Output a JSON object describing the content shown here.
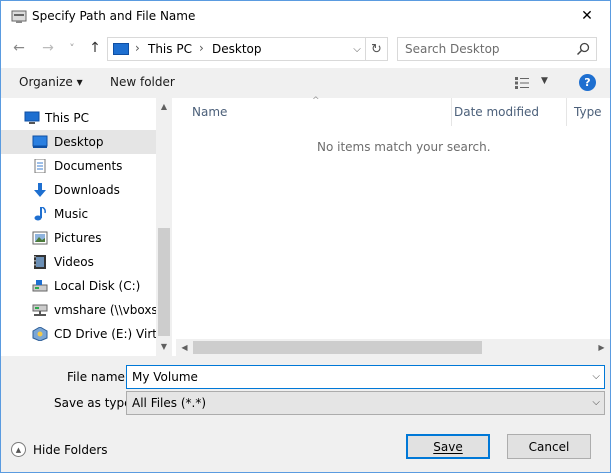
{
  "window": {
    "title": "Specify Path and File Name",
    "close_glyph": "✕"
  },
  "address_bar": {
    "back_glyph": "←",
    "forward_glyph": "→",
    "recent_glyph": "˅",
    "up_glyph": "↑",
    "crumbs": [
      "This PC",
      "Desktop"
    ],
    "separator": "›",
    "dropdown_glyph": "⌵",
    "refresh_glyph": "↻"
  },
  "search": {
    "placeholder": "Search Desktop"
  },
  "toolbar": {
    "organize_label": "Organize ▾",
    "new_folder_label": "New folder",
    "view_dropdown_glyph": "▼",
    "help_glyph": "?"
  },
  "nav": {
    "items": [
      {
        "label": "This PC",
        "icon": "this-pc-icon",
        "selected": false
      },
      {
        "label": "Desktop",
        "icon": "desktop-icon",
        "selected": true
      },
      {
        "label": "Documents",
        "icon": "documents-icon",
        "selected": false
      },
      {
        "label": "Downloads",
        "icon": "downloads-icon",
        "selected": false
      },
      {
        "label": "Music",
        "icon": "music-icon",
        "selected": false
      },
      {
        "label": "Pictures",
        "icon": "pictures-icon",
        "selected": false
      },
      {
        "label": "Videos",
        "icon": "videos-icon",
        "selected": false
      },
      {
        "label": "Local Disk (C:)",
        "icon": "local-disk-icon",
        "selected": false
      },
      {
        "label": "vmshare (\\\\vboxsrv",
        "icon": "network-drive-icon",
        "selected": false
      },
      {
        "label": "CD Drive (E:) Virtua",
        "icon": "cd-drive-icon",
        "selected": false
      }
    ],
    "scroll_up_glyph": "▲",
    "scroll_down_glyph": "▼"
  },
  "file_list": {
    "columns": [
      "Name",
      "Date modified",
      "Type"
    ],
    "sort_glyph": "^",
    "empty_message": "No items match your search.",
    "scroll_left_glyph": "◀",
    "scroll_right_glyph": "▶"
  },
  "form": {
    "file_name_label": "File name:",
    "file_name_value": "My Volume",
    "save_as_type_label": "Save as type:",
    "save_as_type_value": "All Files (*.*)",
    "dropdown_glyph": "⌵"
  },
  "footer": {
    "hide_folders_label": "Hide Folders",
    "hide_folders_glyph": "▲",
    "save_label": "Save",
    "cancel_label": "Cancel"
  },
  "colors": {
    "accent": "#0078d7",
    "selected_bg": "#e5e5e5",
    "panel_bg": "#f0f0f0",
    "header_text": "#4c607a"
  }
}
